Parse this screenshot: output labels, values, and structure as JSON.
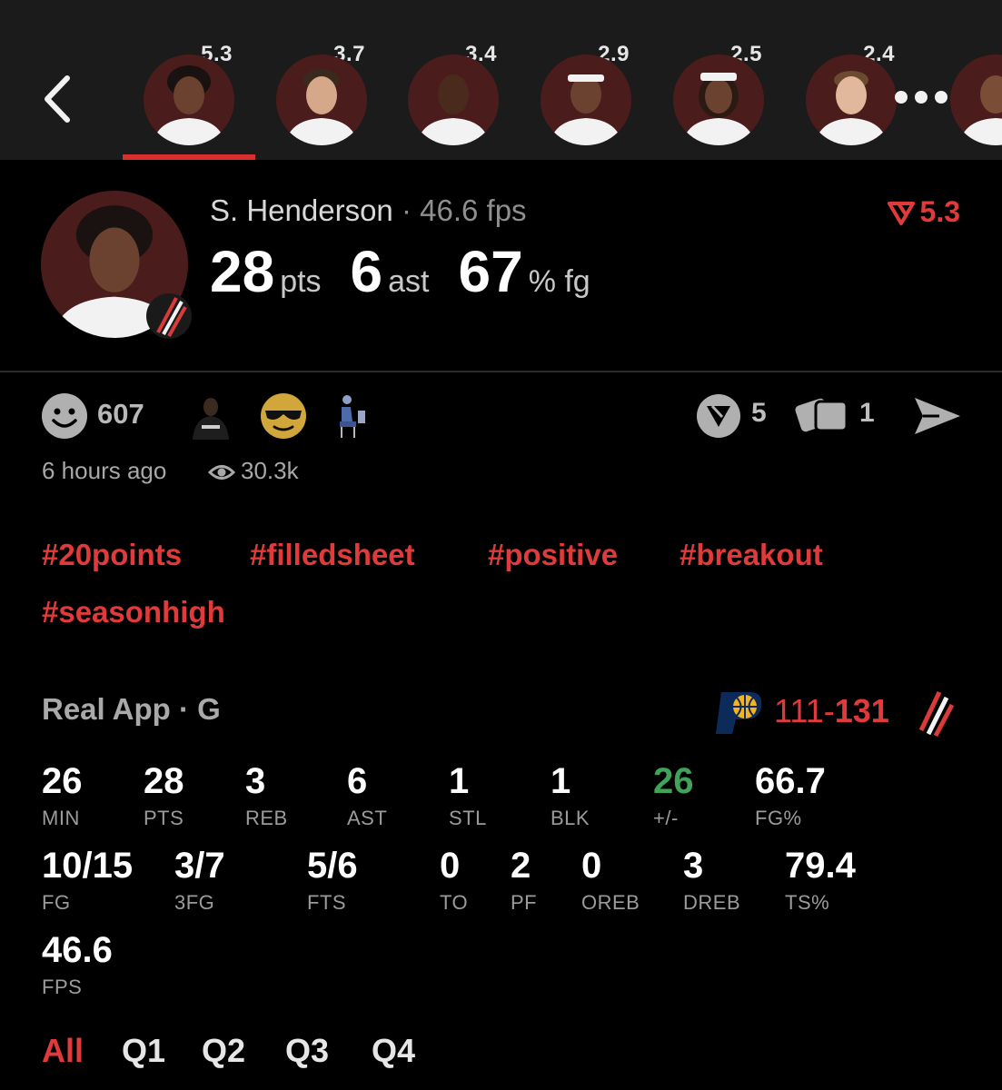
{
  "header": {
    "players": [
      {
        "score": "5.3",
        "name": "player-1",
        "selected": true
      },
      {
        "score": "3.7",
        "name": "player-2"
      },
      {
        "score": "3.4",
        "name": "player-3"
      },
      {
        "score": "2.9",
        "name": "player-4"
      },
      {
        "score": "2.5",
        "name": "player-5"
      },
      {
        "score": "2.4",
        "name": "player-6"
      }
    ]
  },
  "hero": {
    "name": "S. Henderson",
    "separator": " · ",
    "fps": "46.6 fps",
    "pts": "28",
    "pts_unit": "pts",
    "ast": "6",
    "ast_unit": "ast",
    "fg": "67",
    "fg_unit": "% fg",
    "rating": "5.3",
    "accent_color": "#e03a3a"
  },
  "reactions": {
    "count": "607",
    "comments": "5",
    "cards": "1",
    "time": "6 hours ago",
    "views": "30.3k"
  },
  "tags": [
    "#20points",
    "#filledsheet",
    "#positive",
    "#breakout",
    "#seasonhigh"
  ],
  "game": {
    "source": "Real App · G",
    "score_away": "111",
    "score_dash": "-",
    "score_home": "131"
  },
  "stats": {
    "row1": [
      {
        "value": "26",
        "label": "MIN"
      },
      {
        "value": "28",
        "label": "PTS"
      },
      {
        "value": "3",
        "label": "REB"
      },
      {
        "value": "6",
        "label": "AST"
      },
      {
        "value": "1",
        "label": "STL"
      },
      {
        "value": "1",
        "label": "BLK"
      },
      {
        "value": "26",
        "label": "+/-"
      },
      {
        "value": "66.7",
        "label": "FG%"
      }
    ],
    "row2": [
      {
        "value": "10/15",
        "label": "FG"
      },
      {
        "value": "3/7",
        "label": "3FG"
      },
      {
        "value": "5/6",
        "label": "FTS"
      },
      {
        "value": "0",
        "label": "TO"
      },
      {
        "value": "2",
        "label": "PF"
      },
      {
        "value": "0",
        "label": "OREB"
      },
      {
        "value": "3",
        "label": "DREB"
      },
      {
        "value": "79.4",
        "label": "TS%"
      }
    ],
    "row3": [
      {
        "value": "46.6",
        "label": "FPS"
      }
    ]
  },
  "quarters": [
    "All",
    "Q1",
    "Q2",
    "Q3",
    "Q4"
  ],
  "colors": {
    "green": "#3fa35a",
    "red": "#e03a3a",
    "pacers_navy": "#0c2b5b",
    "pacers_gold": "#f5b323"
  }
}
